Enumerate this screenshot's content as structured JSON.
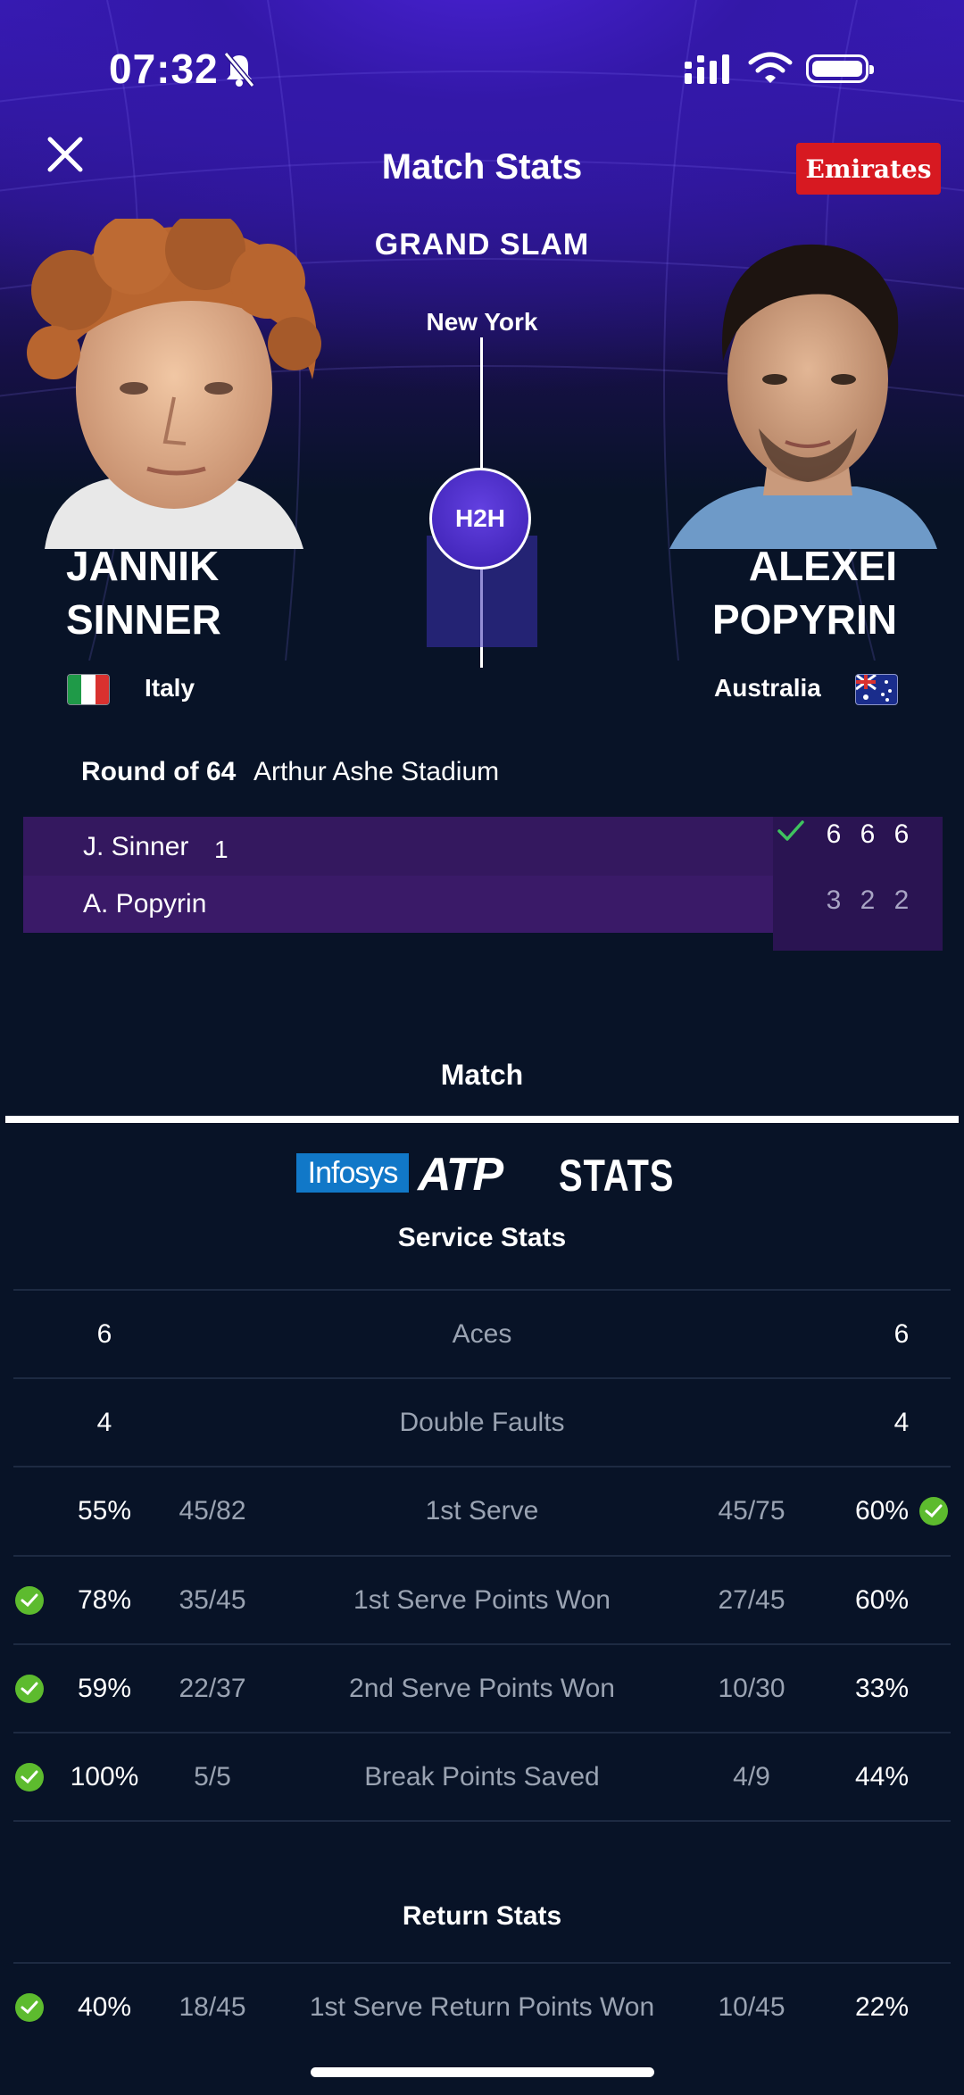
{
  "status_bar": {
    "time": "07:32"
  },
  "header": {
    "title": "Match Stats",
    "sponsor": "Emirates"
  },
  "event": {
    "tournament": "GRAND SLAM",
    "city": "New York",
    "h2h_label": "H2H"
  },
  "players": [
    {
      "first": "JANNIK",
      "last": "SINNER",
      "country": "Italy"
    },
    {
      "first": "ALEXEI",
      "last": "POPYRIN",
      "country": "Australia"
    }
  ],
  "match": {
    "round": "Round of 64",
    "venue": "Arthur Ashe Stadium",
    "scores": [
      {
        "name": "J. Sinner",
        "seed": "1",
        "sets": [
          "6",
          "6",
          "6"
        ],
        "winner": true
      },
      {
        "name": "A. Popyrin",
        "seed": "",
        "sets": [
          "3",
          "2",
          "2"
        ],
        "winner": false
      }
    ]
  },
  "tabs": {
    "active": "Match"
  },
  "branding": {
    "infosys": "Infosys",
    "atp": "ATP",
    "stats": "STATS"
  },
  "service_stats": {
    "title": "Service Stats",
    "rows": [
      {
        "label": "Aces",
        "left": "6",
        "right": "6"
      },
      {
        "label": "Double Faults",
        "left": "4",
        "right": "4"
      },
      {
        "label": "1st Serve",
        "left_pct": "55%",
        "left_ratio": "45/82",
        "right_ratio": "45/75",
        "right_pct": "60%",
        "leader": "right"
      },
      {
        "label": "1st Serve Points Won",
        "left_pct": "78%",
        "left_ratio": "35/45",
        "right_ratio": "27/45",
        "right_pct": "60%",
        "leader": "left"
      },
      {
        "label": "2nd Serve Points Won",
        "left_pct": "59%",
        "left_ratio": "22/37",
        "right_ratio": "10/30",
        "right_pct": "33%",
        "leader": "left"
      },
      {
        "label": "Break Points Saved",
        "left_pct": "100%",
        "left_ratio": "5/5",
        "right_ratio": "4/9",
        "right_pct": "44%",
        "leader": "left"
      }
    ]
  },
  "return_stats": {
    "title": "Return Stats",
    "rows": [
      {
        "label": "1st Serve Return Points Won",
        "left_pct": "40%",
        "left_ratio": "18/45",
        "right_ratio": "10/45",
        "right_pct": "22%",
        "leader": "left"
      }
    ]
  },
  "colors": {
    "accent_purple": "#3b1cc0",
    "win_green": "#5dbb2e",
    "sponsor_red": "#d71921",
    "background": "#081327"
  }
}
